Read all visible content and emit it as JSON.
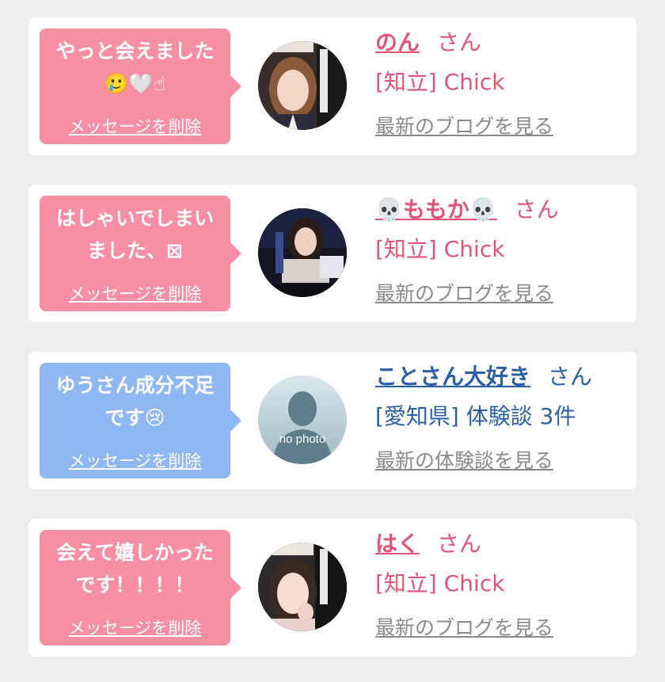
{
  "colors": {
    "pink_bubble": "#f78fa3",
    "blue_bubble": "#8fb8f3",
    "pink_text": "#e05478",
    "blue_text": "#2d5fa6",
    "link_gray": "#8a8a8a"
  },
  "messages": [
    {
      "message": "やっと会えました\n🥲🤍☝",
      "delete_label": "メッセージを削除",
      "name": "のん",
      "honorific": "さん",
      "shop": "[知立] Chick",
      "blog_link": "最新のブログを見る",
      "theme": "pink",
      "avatar": "photo"
    },
    {
      "message": "はしゃいでしまい\nました、⊠",
      "delete_label": "メッセージを削除",
      "name_prefix_icon": "💀",
      "name": "ももか",
      "name_suffix_icon": "💀",
      "honorific": "さん",
      "shop": "[知立] Chick",
      "blog_link": "最新のブログを見る",
      "theme": "pink",
      "avatar": "photo"
    },
    {
      "message": "ゆうさん成分不足\nです😢",
      "delete_label": "メッセージを削除",
      "name": "ことさん大好き",
      "honorific": "さん",
      "shop": "[愛知県] 体験談 3件",
      "blog_link": "最新の体験談を見る",
      "theme": "blue",
      "avatar": "no-photo",
      "avatar_text": "no photo"
    },
    {
      "message": "会えて嬉しかった\nです！！！！",
      "delete_label": "メッセージを削除",
      "name": "はく",
      "honorific": "さん",
      "shop": "[知立] Chick",
      "blog_link": "最新のブログを見る",
      "theme": "pink",
      "avatar": "photo"
    }
  ]
}
